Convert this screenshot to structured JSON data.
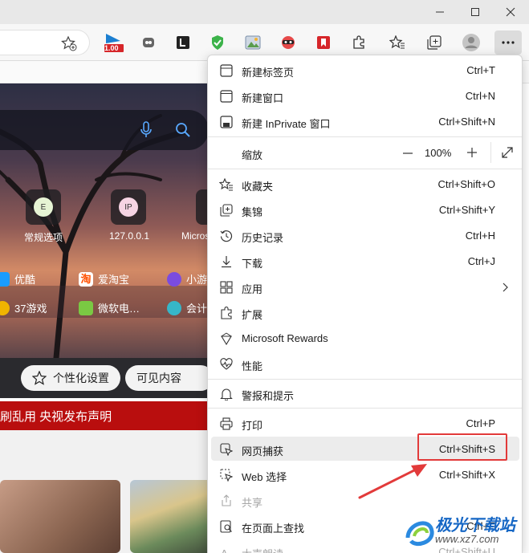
{
  "toolbar": {
    "extension_badge": "1.00"
  },
  "newtab": {
    "sites": [
      {
        "letter": "E",
        "label": "常规选项"
      },
      {
        "letter": "IP",
        "label": "127.0.0.1"
      },
      {
        "letter": "",
        "label": "Micros"
      }
    ],
    "quick_links": [
      {
        "label": "优酷",
        "color": "#1a9cff"
      },
      {
        "label": "爱淘宝",
        "color": "#ff5000"
      },
      {
        "label": "小游",
        "color": "#7a4ce0"
      },
      {
        "label": "37游戏",
        "color": "#f0b400"
      },
      {
        "label": "微软电…",
        "color": "#7ac943"
      },
      {
        "label": "会计",
        "color": "#36b6c8"
      }
    ],
    "taobao_glyph": "淘",
    "personalize_label": "个性化设置",
    "visible_content_label": "可见内容",
    "news_banner": "刷乱用 央视发布声明"
  },
  "menu": {
    "items": [
      {
        "label": "新建标签页",
        "shortcut": "Ctrl+T"
      },
      {
        "label": "新建窗口",
        "shortcut": "Ctrl+N"
      },
      {
        "label": "新建 InPrivate 窗口",
        "shortcut": "Ctrl+Shift+N"
      },
      {
        "label": "收藏夹",
        "shortcut": "Ctrl+Shift+O"
      },
      {
        "label": "集锦",
        "shortcut": "Ctrl+Shift+Y"
      },
      {
        "label": "历史记录",
        "shortcut": "Ctrl+H"
      },
      {
        "label": "下载",
        "shortcut": "Ctrl+J"
      },
      {
        "label": "应用",
        "shortcut": ""
      },
      {
        "label": "扩展",
        "shortcut": ""
      },
      {
        "label": "Microsoft Rewards",
        "shortcut": ""
      },
      {
        "label": "性能",
        "shortcut": ""
      },
      {
        "label": "警报和提示",
        "shortcut": ""
      },
      {
        "label": "打印",
        "shortcut": "Ctrl+P"
      },
      {
        "label": "网页捕获",
        "shortcut": "Ctrl+Shift+S"
      },
      {
        "label": "Web 选择",
        "shortcut": "Ctrl+Shift+X"
      },
      {
        "label": "共享",
        "shortcut": ""
      },
      {
        "label": "在页面上查找",
        "shortcut": "Ctrl+F"
      },
      {
        "label": "大声朗读",
        "shortcut": "Ctrl+Shift+U"
      }
    ],
    "zoom": {
      "label": "缩放",
      "value": "100%"
    }
  },
  "watermark": {
    "title": "极光下载站",
    "url": "www.xz7.com"
  },
  "colors": {
    "highlight": "#e23a3a",
    "accent": "#1667c5"
  }
}
